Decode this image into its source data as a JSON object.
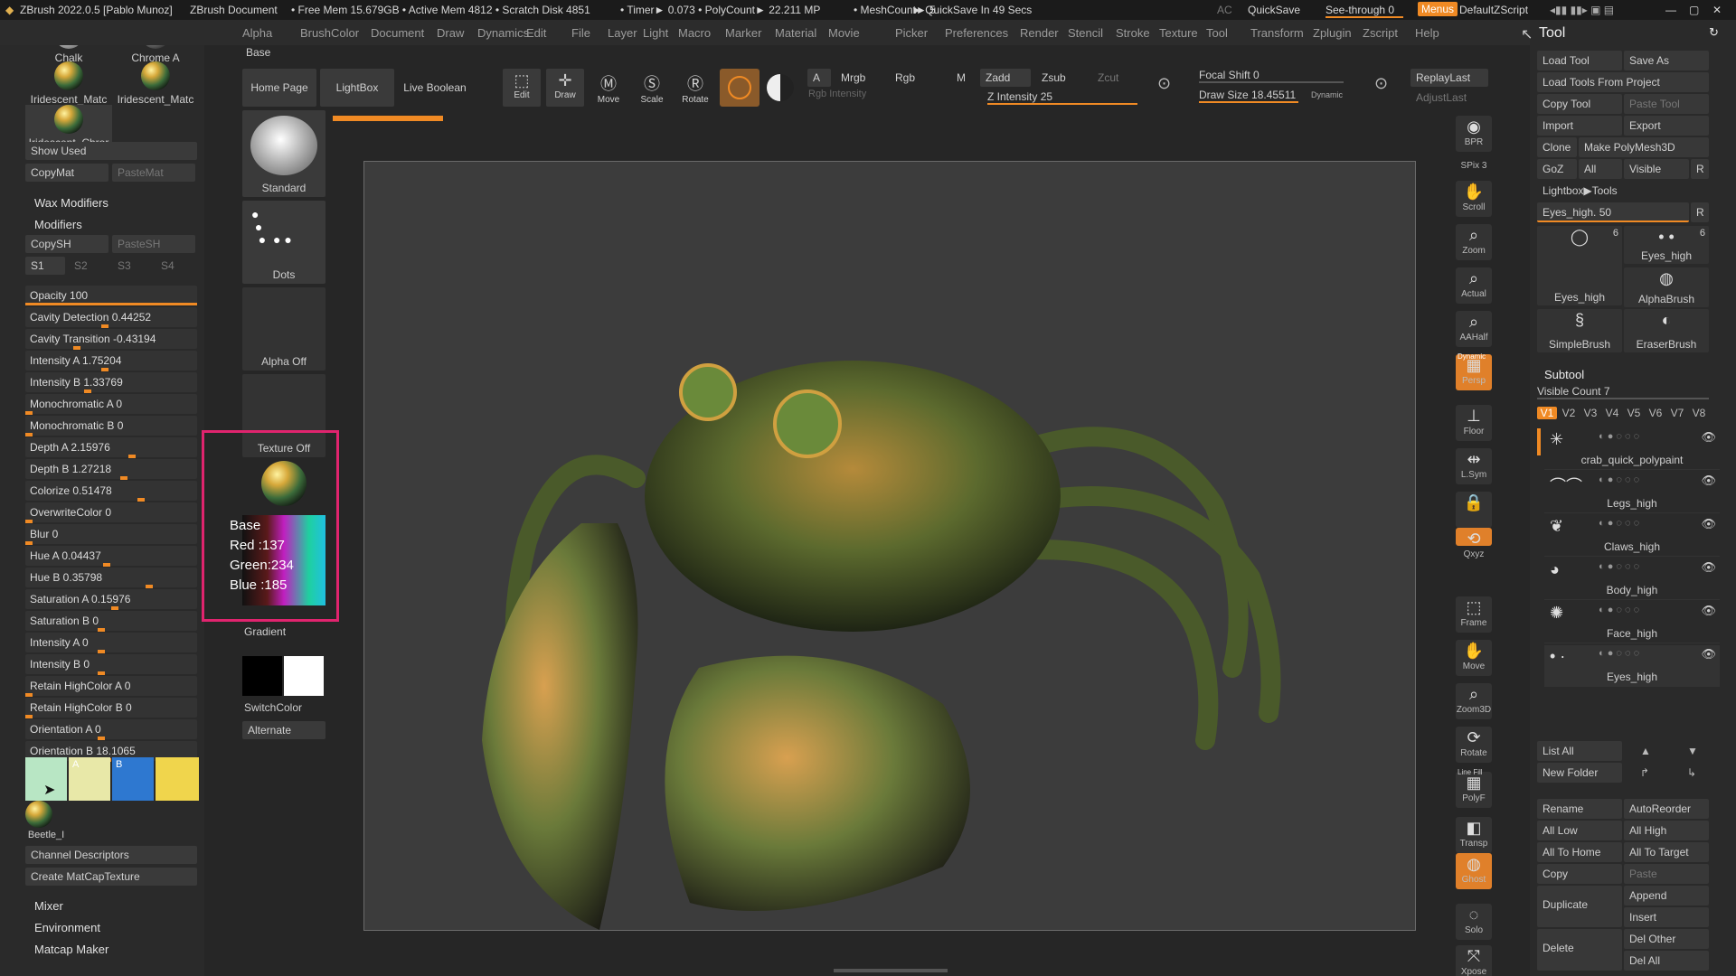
{
  "titlebar": {
    "app": "ZBrush 2022.0.5 [Pablo Munoz]",
    "doc": "ZBrush Document",
    "freemem": "• Free Mem 15.679GB • Active Mem 4812 • Scratch Disk 4851",
    "timer": "• Timer► 0.073 • PolyCount► 22.211 MP",
    "mesh": "• MeshCount► 5",
    "quicksave_info": "► QuickSave In 49 Secs",
    "ac": "AC",
    "quicksave": "QuickSave",
    "seethrough": "See-through 0",
    "menus": "Menus",
    "script": "DefaultZScript"
  },
  "menus": [
    "Alpha",
    "Brush",
    "Color",
    "Document",
    "Draw",
    "Dynamics",
    "Edit",
    "File",
    "Layer",
    "Light",
    "Macro",
    "Marker",
    "Material",
    "Movie",
    "Picker",
    "Preferences",
    "Render",
    "Stencil",
    "Stroke",
    "Texture",
    "Tool",
    "Transform",
    "Zplugin",
    "Zscript",
    "Help"
  ],
  "base_label": "Base",
  "toolbar": {
    "home": "Home Page",
    "lightbox": "LightBox",
    "liveboolean": "Live Boolean",
    "edit": "Edit",
    "draw": "Draw",
    "move": "Move",
    "scale": "Scale",
    "rotate": "Rotate",
    "a": "A",
    "mrgb": "Mrgb",
    "rgb": "Rgb",
    "m": "M",
    "rgb_intensity": "Rgb Intensity",
    "zadd": "Zadd",
    "zsub": "Zsub",
    "zcut": "Zcut",
    "z_intensity": "Z Intensity 25",
    "focal": "Focal Shift 0",
    "drawsize": "Draw Size 18.45511",
    "dynamic": "Dynamic",
    "replay": "ReplayLast",
    "adjust": "AdjustLast"
  },
  "materials": {
    "chalk": "Chalk",
    "chrome": "Chrome A",
    "irid1": "Iridescent_Matc",
    "irid2": "Iridescent_Matc",
    "irid3": "Iridescent_Chror",
    "show_used": "Show Used",
    "copymat": "CopyMat",
    "pastemat": "PasteMat"
  },
  "wax": "Wax Modifiers",
  "modifiers": {
    "title": "Modifiers",
    "copysh": "CopySH",
    "pastesh": "PasteSH",
    "s1": "S1",
    "s2": "S2",
    "s3": "S3",
    "s4": "S4"
  },
  "sliders": [
    {
      "label": "Opacity 100",
      "value": 1.0
    },
    {
      "label": "Cavity Detection 0.44252",
      "value": 0.44
    },
    {
      "label": "Cavity Transition -0.43194",
      "value": 0.28
    },
    {
      "label": "Intensity A 1.75204",
      "value": 0.44
    },
    {
      "label": "Intensity B 1.33769",
      "value": 0.34
    },
    {
      "label": "Monochromatic A 0",
      "value": 0
    },
    {
      "label": "Monochromatic B 0",
      "value": 0
    },
    {
      "label": "Depth A 2.15976",
      "value": 0.6
    },
    {
      "label": "Depth B 1.27218",
      "value": 0.55
    },
    {
      "label": "Colorize 0.51478",
      "value": 0.65
    },
    {
      "label": "OverwriteColor 0",
      "value": 0
    },
    {
      "label": "Blur 0",
      "value": 0
    },
    {
      "label": "Hue A 0.04437",
      "value": 0.45
    },
    {
      "label": "Hue B 0.35798",
      "value": 0.7
    },
    {
      "label": "Saturation A 0.15976",
      "value": 0.5
    },
    {
      "label": "Saturation B 0",
      "value": 0.42
    },
    {
      "label": "Intensity A 0",
      "value": 0.42
    },
    {
      "label": "Intensity B 0",
      "value": 0.42
    },
    {
      "label": "Retain HighColor A 0",
      "value": 0
    },
    {
      "label": "Retain HighColor B 0",
      "value": 0
    },
    {
      "label": "Orientation A 0",
      "value": 0.42
    },
    {
      "label": "Orientation B 18.1065",
      "value": 0.46
    }
  ],
  "swatches": {
    "a": "A",
    "b": "B",
    "colors": [
      "#b8e6c4",
      "#e8e8a8",
      "#2e78d0",
      "#f0d54c"
    ]
  },
  "beetle": "Beetle_I",
  "channel": "Channel Descriptors",
  "create": "Create MatCapTexture",
  "mixer": "Mixer",
  "environment": "Environment",
  "matcapmaker": "Matcap Maker",
  "col2": {
    "standard": "Standard",
    "dots": "Dots",
    "alphaoff": "Alpha Off",
    "textureoff": "Texture Off",
    "gradient": "Gradient",
    "switchcolor": "SwitchColor",
    "alternate": "Alternate"
  },
  "colorinfo": {
    "title": "Base",
    "red": "Red  :137",
    "green": "Green:234",
    "blue": "Blue :185"
  },
  "rtool": [
    {
      "n": "bpr",
      "t": "BPR"
    },
    {
      "n": "spix",
      "t": "SPix 3"
    },
    {
      "n": "scroll",
      "t": "Scroll"
    },
    {
      "n": "zoom",
      "t": "Zoom"
    },
    {
      "n": "actual",
      "t": "Actual"
    },
    {
      "n": "aahalf",
      "t": "AAHalf"
    },
    {
      "n": "persp",
      "t": "Persp"
    },
    {
      "n": "floor",
      "t": "Floor"
    },
    {
      "n": "lsym",
      "t": "L.Sym"
    },
    {
      "n": "lock",
      "t": ""
    },
    {
      "n": "xyz",
      "t": "Qxyz"
    },
    {
      "n": "frame",
      "t": "Frame"
    },
    {
      "n": "move",
      "t": "Move"
    },
    {
      "n": "zoom3d",
      "t": "Zoom3D"
    },
    {
      "n": "rotate",
      "t": "Rotate"
    },
    {
      "n": "polyf",
      "t": "PolyF"
    },
    {
      "n": "transp",
      "t": "Transp"
    },
    {
      "n": "ghost",
      "t": "Ghost"
    },
    {
      "n": "solo",
      "t": "Solo"
    },
    {
      "n": "xpose",
      "t": "Xpose"
    }
  ],
  "rtool_labels": {
    "dynamic": "Dynamic",
    "linefill": "Line Fill"
  },
  "tool": {
    "title": "Tool",
    "load": "Load Tool",
    "saveas": "Save As",
    "loadfrom": "Load Tools From Project",
    "copy": "Copy Tool",
    "paste": "Paste Tool",
    "import": "Import",
    "export": "Export",
    "clone": "Clone",
    "makepoly": "Make PolyMesh3D",
    "goz": "GoZ",
    "all": "All",
    "visible": "Visible",
    "r": "R",
    "lightbox": "Lightbox▶Tools",
    "eyes": "Eyes_high. 50",
    "r2": "R",
    "thumbs": [
      {
        "name": "Eyes_high",
        "count": "6"
      },
      {
        "name": "Eyes_high",
        "count": "6"
      },
      {
        "name": "AlphaBrush"
      },
      {
        "name": "SimpleBrush"
      },
      {
        "name": "EraserBrush"
      }
    ]
  },
  "subtool": {
    "title": "Subtool",
    "visible": "Visible Count 7",
    "versions": [
      "V1",
      "V2",
      "V3",
      "V4",
      "V5",
      "V6",
      "V7",
      "V8"
    ],
    "items": [
      "crab_quick_polypaint",
      "Legs_high",
      "Claws_high",
      "Body_high",
      "Face_high",
      "Eyes_high"
    ]
  },
  "actions": {
    "listall": "List All",
    "newfolder": "New Folder",
    "rename": "Rename",
    "autoreorder": "AutoReorder",
    "alllow": "All Low",
    "allhigh": "All High",
    "alltohome": "All To Home",
    "alltotarget": "All To Target",
    "copy": "Copy",
    "paste": "Paste",
    "append": "Append",
    "duplicate": "Duplicate",
    "insert": "Insert",
    "delete": "Delete",
    "delother": "Del Other",
    "delall": "Del All"
  }
}
